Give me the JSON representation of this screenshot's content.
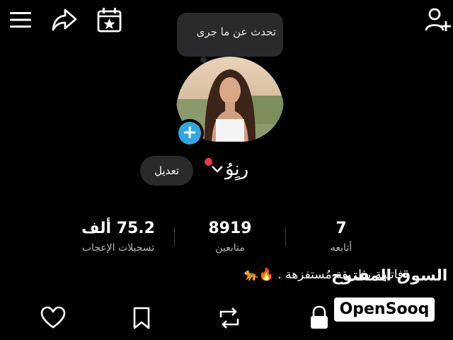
{
  "header": {
    "icons": [
      "menu-icon",
      "share-icon",
      "calendar-star-icon",
      "add-user-icon"
    ]
  },
  "note_bubble": {
    "text": "تحدث عن ما جرى"
  },
  "profile": {
    "username": "رنٍوُ",
    "edit_label": "تعديل"
  },
  "stats": [
    {
      "value": "7",
      "label": "أتابعه"
    },
    {
      "value": "8919",
      "label": "متابعين"
    },
    {
      "value": "75.2 ألف",
      "label": "تسجيلات الإعجاب"
    }
  ],
  "bio": "فاتنهة بطريقة مُستفزهة . 🔥🐆",
  "tabs": [
    "heart-icon",
    "bookmark-icon",
    "repost-icon",
    "lock-icon"
  ],
  "watermark": {
    "arabic": "السوق المفتوح",
    "english": "OpenSooq"
  },
  "colors": {
    "accent": "#2fa7e0",
    "notification": "#f0354d",
    "background": "#000000"
  }
}
